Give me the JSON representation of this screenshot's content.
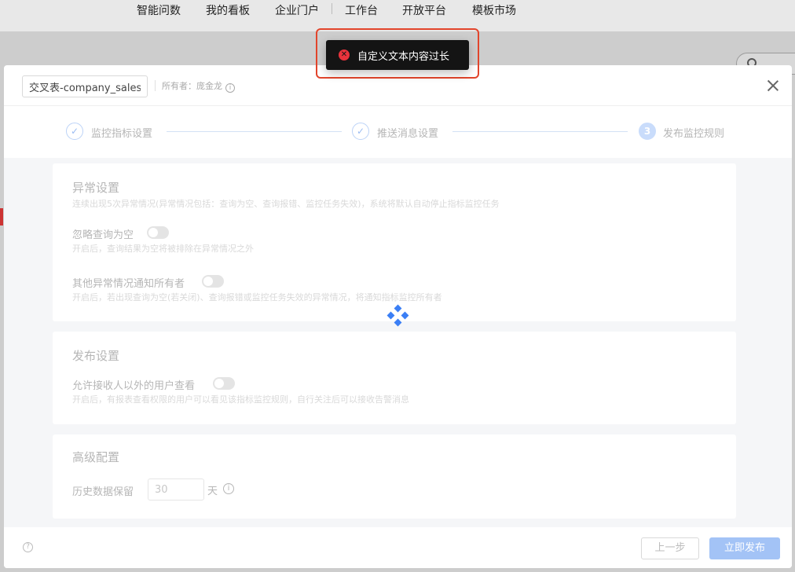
{
  "topnav": {
    "items": [
      "智能问数",
      "我的看板",
      "企业门户",
      "工作台",
      "开放平台",
      "模板市场"
    ]
  },
  "modal": {
    "title_value": "交叉表-company_sales",
    "owner_text": "所有者：庞金龙",
    "steps": [
      {
        "label": "监控指标设置",
        "status": "done"
      },
      {
        "label": "推送消息设置",
        "status": "done"
      },
      {
        "label": "发布监控规则",
        "status": "active",
        "number": "3"
      }
    ],
    "exception": {
      "title": "异常设置",
      "desc": "连续出现5次异常情况(异常情况包括：查询为空、查询报错、监控任务失效)，系统将默认自动停止指标监控任务",
      "ignore_empty_label": "忽略查询为空",
      "ignore_empty_desc": "开启后，查询结果为空将被排除在异常情况之外",
      "notify_owner_label": "其他异常情况通知所有者",
      "notify_owner_desc": "开启后，若出现查询为空(若关闭)、查询报错或监控任务失效的异常情况，将通知指标监控所有者"
    },
    "publish": {
      "title": "发布设置",
      "allow_view_label": "允许接收人以外的用户查看",
      "allow_view_desc": "开启后，有报表查看权限的用户可以看见该指标监控规则，自行关注后可以接收告警消息"
    },
    "advanced": {
      "title": "高级配置",
      "history_label": "历史数据保留",
      "history_value": "30",
      "history_unit": "天"
    },
    "footer": {
      "prev_label": "上一步",
      "publish_label": "立即发布"
    }
  },
  "toast": {
    "message": "自定义文本内容过长",
    "type": "error"
  },
  "icons": {
    "close": "close-icon",
    "info": "info-icon",
    "help": "help-icon",
    "check": "check-icon",
    "error": "error-icon",
    "spinner": "loading-spinner-icon",
    "search": "search-icon"
  },
  "colors": {
    "primary_disabled": "#a3c3f6",
    "spinner": "#3b7ff5",
    "toast_bg": "#141414",
    "error": "#e8333c",
    "highlight": "#e2452c"
  }
}
